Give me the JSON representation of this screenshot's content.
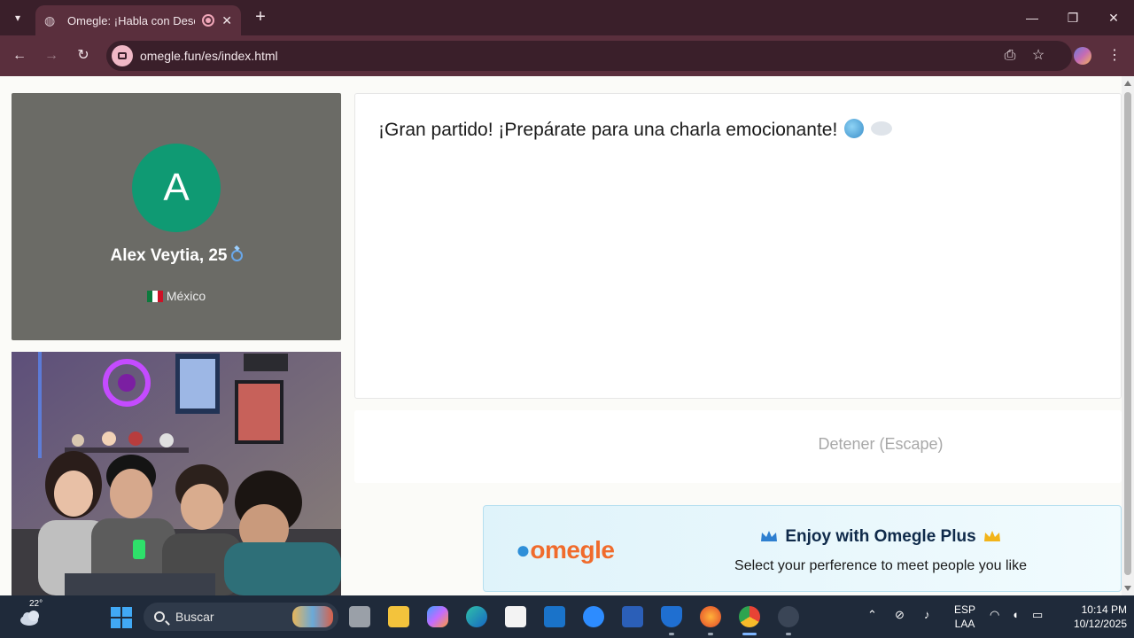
{
  "browser": {
    "tab_title": "Omegle: ¡Habla con Descon",
    "url": "omegle.fun/es/index.html"
  },
  "stranger": {
    "avatar_letter": "A",
    "name": "Alex Veytia, 25",
    "country": "México"
  },
  "chat": {
    "message": "¡Gran partido! ¡Prepárate para una charla emocionante!"
  },
  "controls": {
    "stop_label": "Detener (Escape)"
  },
  "promo": {
    "logo_text": "omegle",
    "title": "Enjoy with Omegle Plus",
    "subtitle": "Select your perference to meet people you like"
  },
  "taskbar": {
    "temperature": "22°",
    "search_placeholder": "Buscar",
    "language_line1": "ESP",
    "language_line2": "LAA",
    "time": "10:14 PM",
    "date": "10/12/2025"
  },
  "colors": {
    "avatar_bg": "#0f9a73",
    "tabstrip_bg": "#3a1f2a",
    "toolbar_bg": "#5a2f3d",
    "logo_orange": "#f06b2c",
    "logo_blue": "#2e8fd8"
  }
}
